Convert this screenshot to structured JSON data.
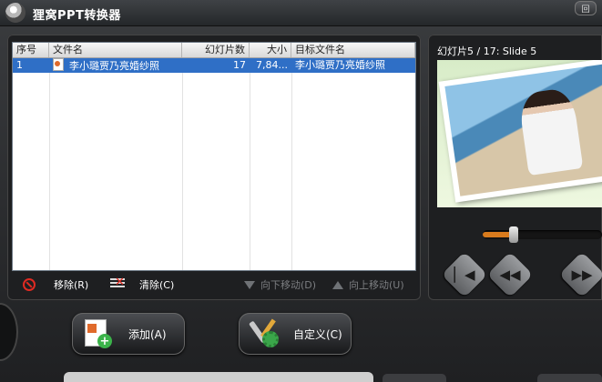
{
  "window": {
    "title": "狸窝PPT转换器",
    "corner_button": "回"
  },
  "file_list": {
    "columns": [
      "序号",
      "文件名",
      "幻灯片数",
      "大小",
      "目标文件名"
    ],
    "rows": [
      {
        "index": "1",
        "filename": "李小璐贾乃亮婚纱照",
        "slides": "17",
        "size": "7,84...",
        "target": "李小璐贾乃亮婚纱照"
      }
    ]
  },
  "toolbar": {
    "remove_label": "移除(R)",
    "clear_label": "清除(C)",
    "move_down_label": "向下移动(D)",
    "move_up_label": "向上移动(U)"
  },
  "preview": {
    "slide_label": "幻灯片5 / 17: Slide 5",
    "progress_fraction": 0.26
  },
  "actions": {
    "add_label": "添加(A)",
    "custom_label": "自定义(C)"
  },
  "colors": {
    "selection": "#2f6fc6",
    "seek": "#d87b1d",
    "remove_icon": "#e02a22"
  },
  "icons": {
    "remove": "no-entry-icon",
    "clear": "clear-list-icon",
    "move_down": "arrow-down-icon",
    "move_up": "arrow-up-icon",
    "prev": "skip-back-icon",
    "rewind": "rewind-icon",
    "forward": "fast-forward-icon",
    "add": "add-ppt-icon",
    "custom": "settings-tools-icon"
  }
}
